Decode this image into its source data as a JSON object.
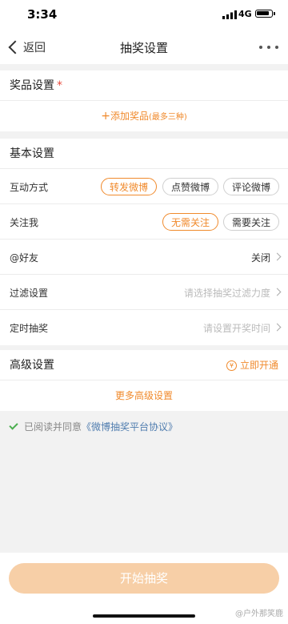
{
  "status": {
    "time": "3:34",
    "network": "4G"
  },
  "nav": {
    "back": "返回",
    "title": "抽奖设置"
  },
  "prize": {
    "title": "奖品设置",
    "required_mark": "*",
    "add_plus": "+",
    "add_label": "添加奖品",
    "add_hint": "(最多三种)"
  },
  "basic": {
    "title": "基本设置",
    "interaction": {
      "label": "互动方式",
      "options": [
        "转发微博",
        "点赞微博",
        "评论微博"
      ],
      "selected": "转发微博"
    },
    "follow": {
      "label": "关注我",
      "options": [
        "无需关注",
        "需要关注"
      ],
      "selected": "无需关注"
    },
    "mention": {
      "label": "@好友",
      "value": "关闭"
    },
    "filter": {
      "label": "过滤设置",
      "placeholder": "请选择抽奖过滤力度"
    },
    "timer": {
      "label": "定时抽奖",
      "placeholder": "请设置开奖时间"
    }
  },
  "advanced": {
    "title": "高级设置",
    "open_icon": "¥",
    "open_label": "立即开通",
    "more_label": "更多高级设置"
  },
  "agreement": {
    "prefix": "已阅读并同意",
    "link": "《微博抽奖平台协议》"
  },
  "footer": {
    "start_label": "开始抽奖",
    "watermark": "@户外那笑鹿"
  },
  "colors": {
    "accent": "#f08a2c",
    "button_disabled": "#f7cfa7",
    "link": "#507daf",
    "check": "#4caf50"
  }
}
